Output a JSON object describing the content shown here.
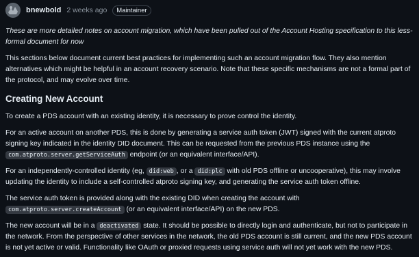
{
  "comment": {
    "author": "bnewbold",
    "time": "2 weeks ago",
    "badge": "Maintainer"
  },
  "intro_italic": "These are more detailed notes on account migration, which have been pulled out of the Account Hosting specification to this less-formal document for now",
  "intro": "This sections below document current best practices for implementing such an account migration flow. They also mention alternatives which might be helpful in an account recovery scenario. Note that these specific mechanisms are not a formal part of the protocol, and may evolve over time.",
  "section_heading": "Creating New Account",
  "para1": "To create a PDS account with an existing identity, it is necessary to prove control the identity.",
  "para2": {
    "a": "For an active account on another PDS, this is done by generating a service auth token (JWT) signed with the current atproto signing key indicated in the identity DID document. This can be requested from the previous PDS instance using the ",
    "code": "com.atproto.server.getServiceAuth",
    "b": " endpoint (or an equivalent interface/API)."
  },
  "para3": {
    "a": "For an independently-controlled identity (eg, ",
    "code1": "did:web",
    "b": ", or a ",
    "code2": "did:plc",
    "c": " with old PDS offline or uncooperative), this may involve updating the identity to include a self-controlled atproto signing key, and generating the service auth token offline."
  },
  "para4": {
    "a": "The service auth token is provided along with the existing DID when creating the account with ",
    "code": "com.atproto.server.createAccount",
    "b": " (or an equivalent interface/API) on the new PDS."
  },
  "para5": {
    "a": "The new account will be in a ",
    "code": "deactivated",
    "b": " state. It should be possible to directly login and authenticate, but not to participate in the network. From the perspective of other services in the network, the old PDS account is still current, and the new PDS account is not yet active or valid. Functionality like OAuth or proxied requests using service auth will not yet work with the new PDS."
  }
}
